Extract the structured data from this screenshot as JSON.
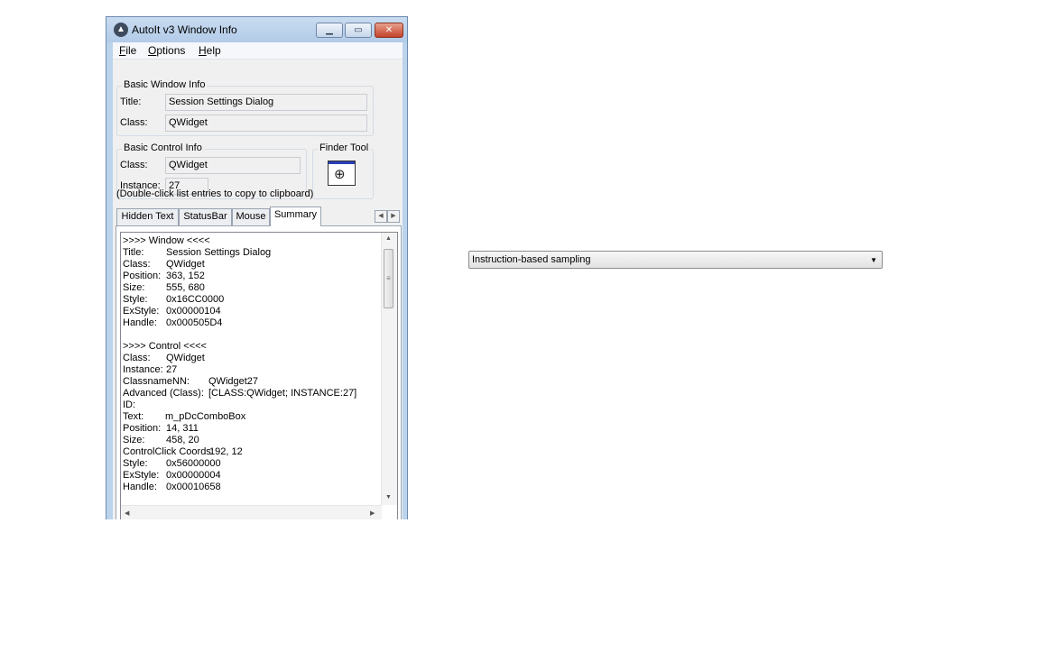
{
  "window": {
    "title": "AutoIt v3 Window Info",
    "app_icon": "autoit-icon",
    "controls": {
      "minimize": "minimize-icon",
      "maximize": "maximize-icon",
      "close": "close-icon"
    }
  },
  "menu": {
    "file": {
      "accel": "F",
      "rest": "ile"
    },
    "options": {
      "accel": "O",
      "rest": "ptions"
    },
    "help": {
      "accel": "H",
      "rest": "elp"
    }
  },
  "basic_window": {
    "title": "Basic Window Info",
    "title_label": "Title:",
    "title_value": "Session Settings Dialog",
    "class_label": "Class:",
    "class_value": "QWidget"
  },
  "basic_control": {
    "title": "Basic Control Info",
    "class_label": "Class:",
    "class_value": "QWidget",
    "instance_label": "Instance:",
    "instance_value": "27"
  },
  "finder": {
    "title": "Finder Tool",
    "icon": "crosshair-target-icon"
  },
  "hint": "(Double-click list entries to copy to clipboard)",
  "tabs": [
    {
      "label": "Hidden Text"
    },
    {
      "label": "StatusBar"
    },
    {
      "label": "Mouse"
    },
    {
      "label": "Summary",
      "active": true
    }
  ],
  "summary": {
    "window_header": ">>>> Window <<<<",
    "window_rows": [
      {
        "key": "Title:",
        "value": "Session Settings Dialog"
      },
      {
        "key": "Class:",
        "value": "QWidget"
      },
      {
        "key": "Position:",
        "value": "363, 152"
      },
      {
        "key": "Size:",
        "value": "555, 680"
      },
      {
        "key": "Style:",
        "value": "0x16CC0000"
      },
      {
        "key": "ExStyle:",
        "value": "0x00000104"
      },
      {
        "key": "Handle:",
        "value": "0x000505D4"
      }
    ],
    "control_header": ">>>> Control <<<<",
    "control_rows": [
      {
        "key": "Class:",
        "value": "QWidget"
      },
      {
        "key": "Instance:",
        "value": "27"
      },
      {
        "key": "ClassnameNN:",
        "value": "QWidget27"
      },
      {
        "key": "Advanced (Class):",
        "value": "[CLASS:QWidget; INSTANCE:27]"
      },
      {
        "key": "ID:",
        "value": ""
      },
      {
        "key": "Text:",
        "value": "m_pDcComboBox"
      },
      {
        "key": "Position:",
        "value": "14, 311"
      },
      {
        "key": "Size:",
        "value": "458, 20"
      },
      {
        "key": "ControlClick Coords:",
        "value": "192, 12"
      },
      {
        "key": "Style:",
        "value": "0x56000000"
      },
      {
        "key": "ExStyle:",
        "value": "0x00000004"
      },
      {
        "key": "Handle:",
        "value": "0x00010658"
      }
    ]
  },
  "combobox": {
    "selected": "Instruction-based sampling"
  }
}
